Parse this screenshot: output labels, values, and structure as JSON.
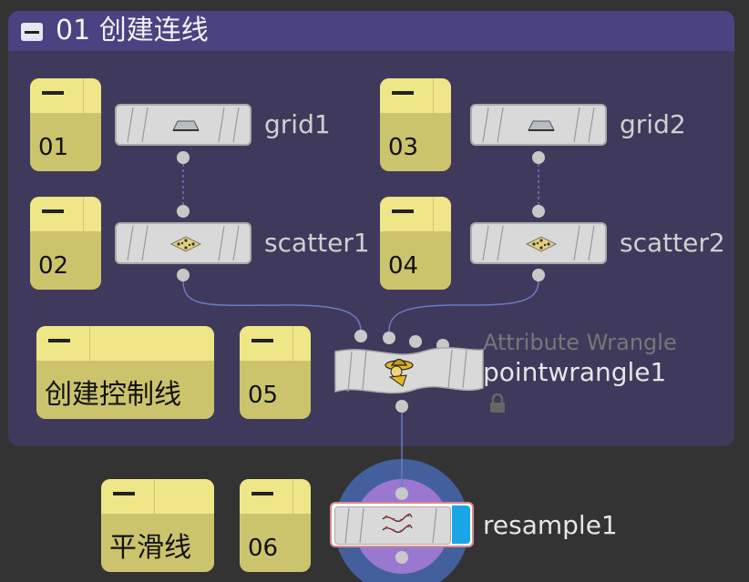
{
  "network_box": {
    "title": "01 创建连线"
  },
  "sticky_notes": [
    {
      "id": "s01",
      "text": "01"
    },
    {
      "id": "s02",
      "text": "02"
    },
    {
      "id": "s03",
      "text": "03"
    },
    {
      "id": "s04",
      "text": "04"
    },
    {
      "id": "s_create",
      "text": "创建控制线"
    },
    {
      "id": "s05",
      "text": "05"
    },
    {
      "id": "s_smooth",
      "text": "平滑线"
    },
    {
      "id": "s06",
      "text": "06"
    }
  ],
  "nodes": {
    "grid1": {
      "name": "grid1",
      "icon": "grid-icon"
    },
    "scatter1": {
      "name": "scatter1",
      "icon": "scatter-icon"
    },
    "grid2": {
      "name": "grid2",
      "icon": "grid-icon"
    },
    "scatter2": {
      "name": "scatter2",
      "icon": "scatter-icon"
    },
    "pointwrangle1": {
      "name": "pointwrangle1",
      "type": "Attribute Wrangle",
      "icon": "wrangle-icon",
      "locked": true
    },
    "resample1": {
      "name": "resample1",
      "icon": "resample-icon",
      "display_flag": true
    }
  },
  "colors": {
    "network_box": "#3f3a5c",
    "network_box_header": "#4b4282",
    "sticky_note": "#ccc46c",
    "sticky_header": "#efe688",
    "node_body": "#d9d9d9",
    "display_flag": "#1aa6e6",
    "selection_ring_outer": "#44609c",
    "selection_ring_inner": "#9a78d2",
    "wire": "#6a7bbf"
  }
}
